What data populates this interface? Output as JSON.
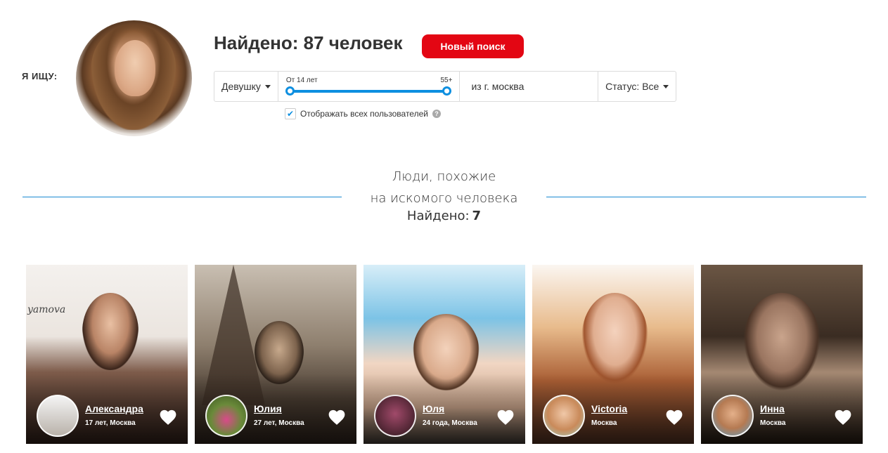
{
  "search": {
    "label": "Я ИЩУ:",
    "found_title": "Найдено: 87 человек",
    "new_search_label": "Новый поиск",
    "gender": "Девушку",
    "age_min": "От 14 лет",
    "age_max": "55+",
    "city": "из г. москва",
    "status": "Статус: Все",
    "show_all_label": "Отображать всех пользователей",
    "show_all_checked": true
  },
  "similar": {
    "title_line1": "Люди, похожие",
    "title_line2": "на искомого человека",
    "count_label": "Найдено:",
    "count_value": "7"
  },
  "people": [
    {
      "name": "Александра",
      "info": "17 лет, Москва"
    },
    {
      "name": "Юлия",
      "info": "27 лет, Москва"
    },
    {
      "name": "Юля",
      "info": "24 года, Москва"
    },
    {
      "name": "Victoria",
      "info": "Москва"
    },
    {
      "name": "Инна",
      "info": "Москва"
    }
  ],
  "decor": {
    "card1_brand": "yamova"
  },
  "colors": {
    "accent": "#e30613",
    "slider": "#0d8fe0",
    "divider": "#1a8ad2"
  }
}
